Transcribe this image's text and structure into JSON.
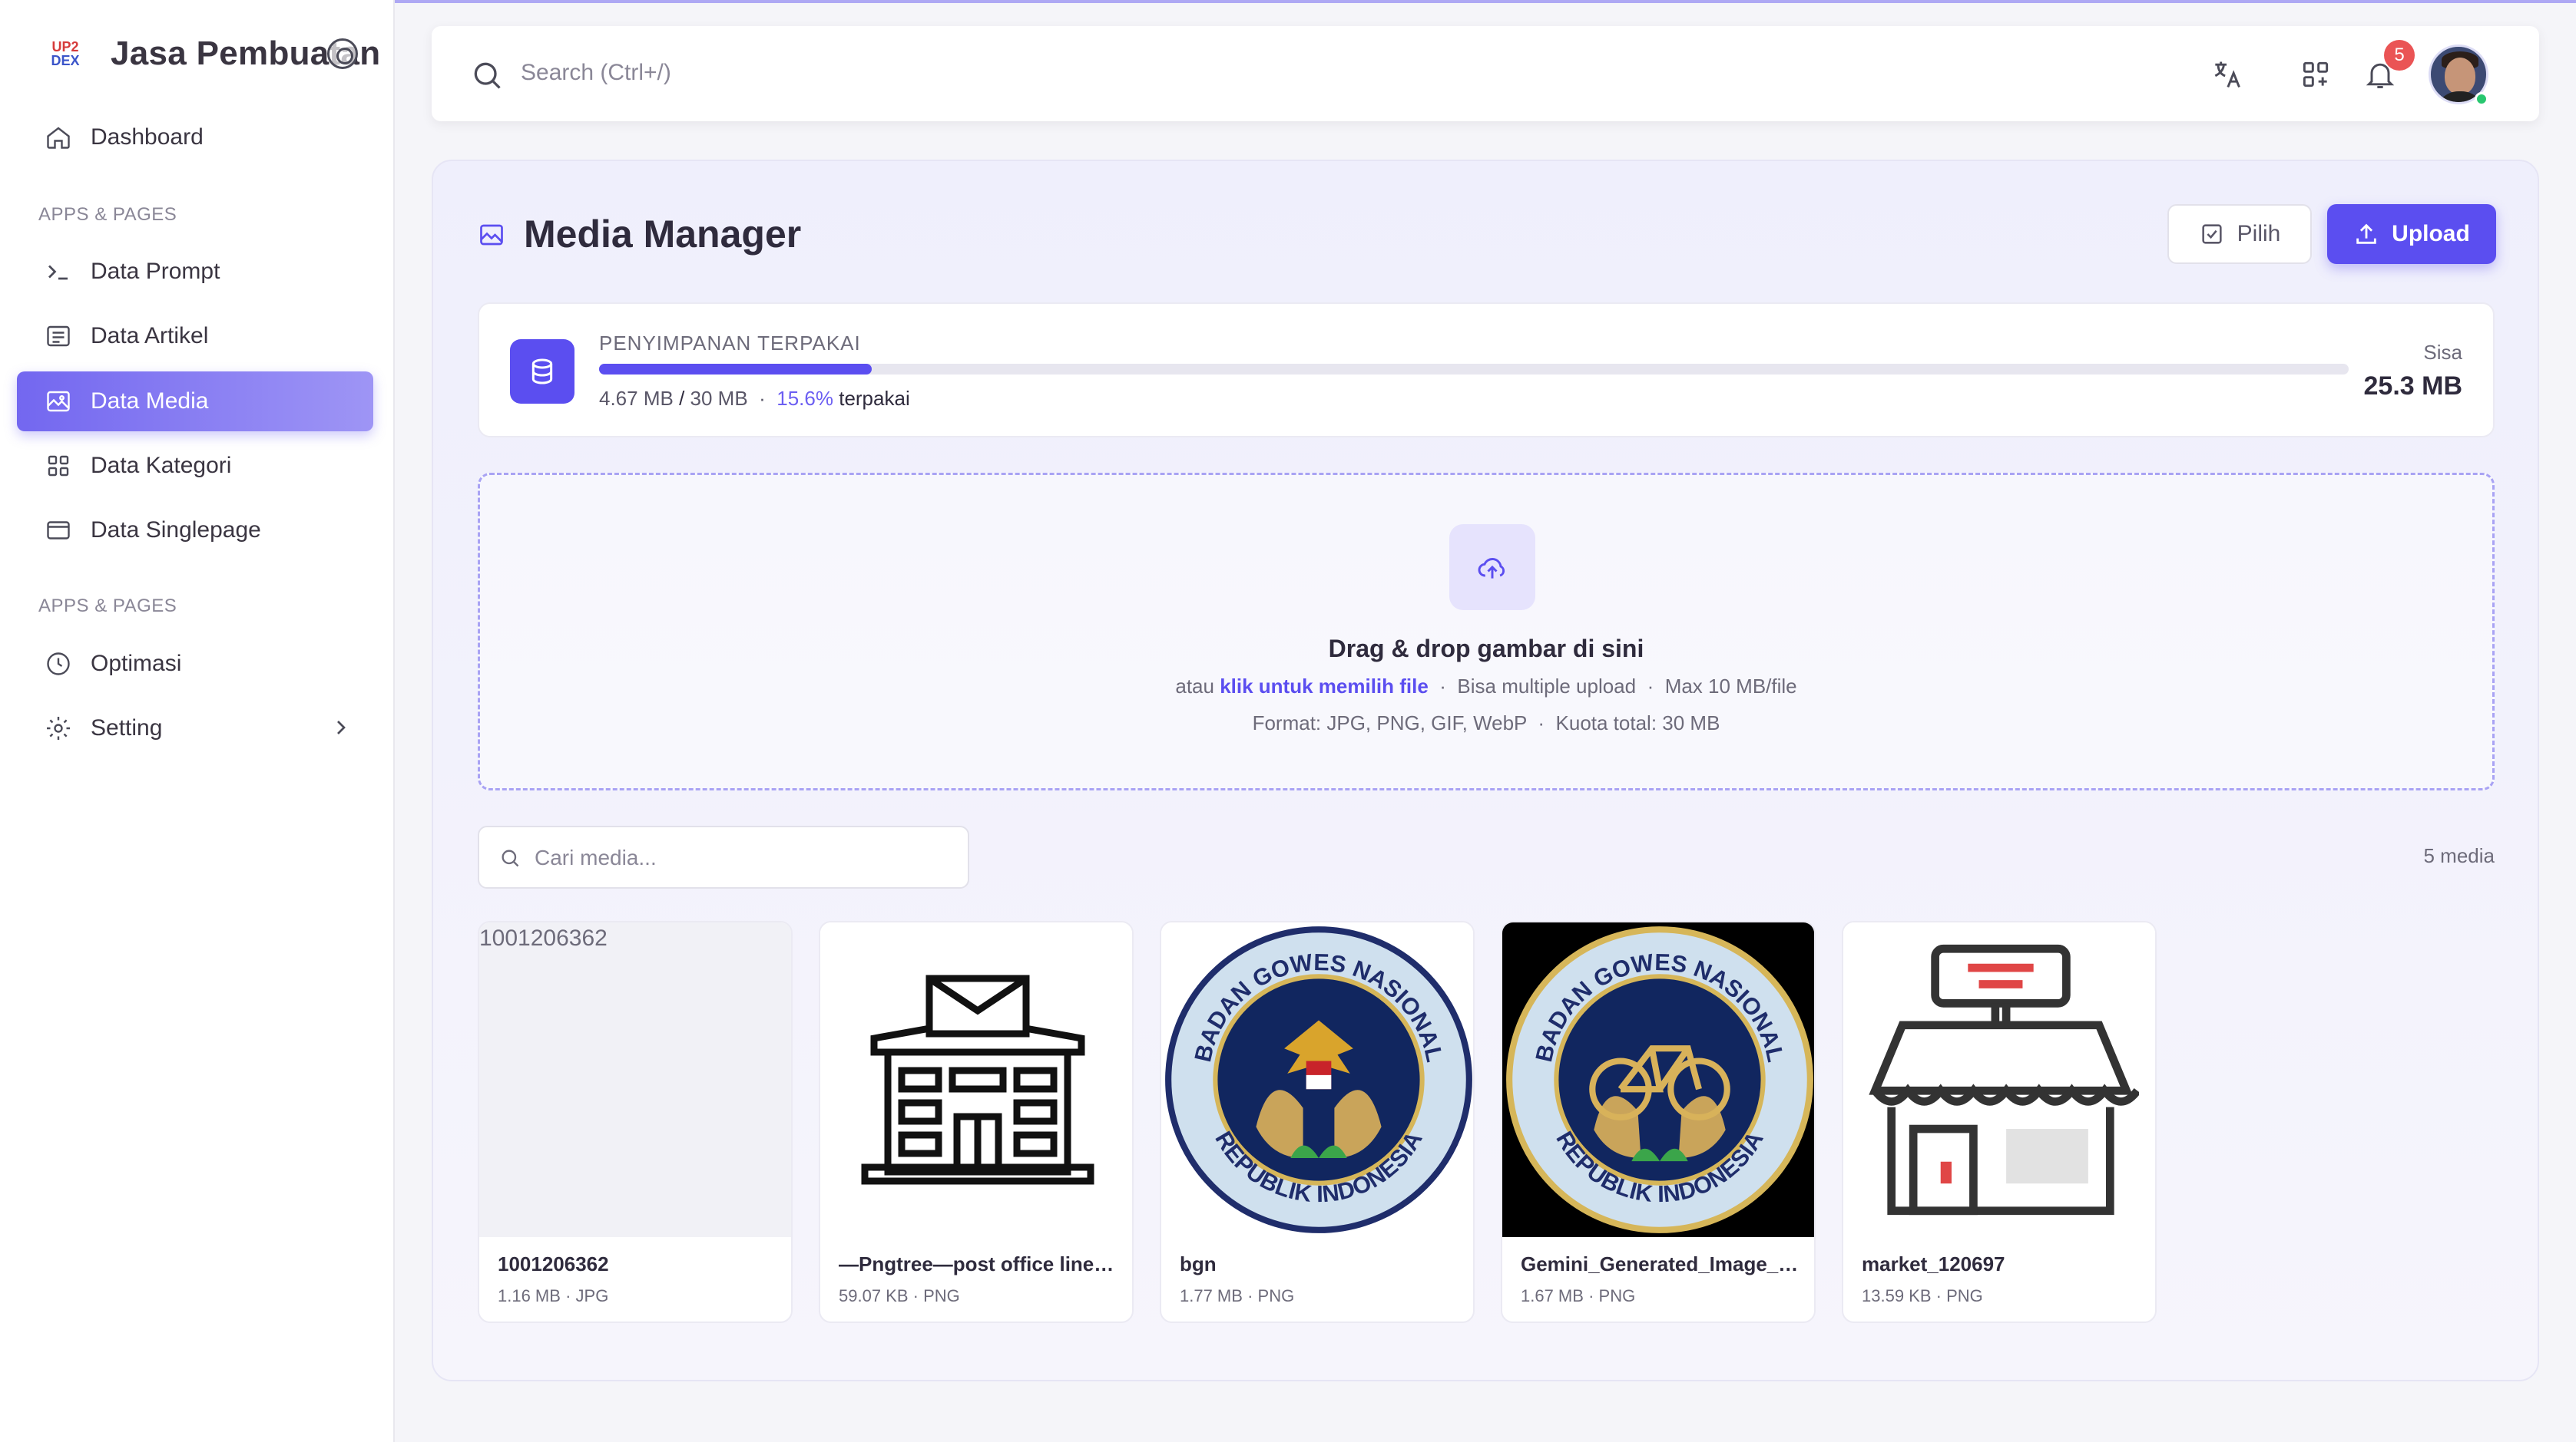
{
  "brand": {
    "logo_top": "UP2",
    "logo_bottom": "DEX",
    "name": "Jasa Pembuatan"
  },
  "sidebar": {
    "dashboard": "Dashboard",
    "section1": "APPS & PAGES",
    "items": [
      {
        "label": "Data Prompt",
        "icon": "terminal-icon"
      },
      {
        "label": "Data Artikel",
        "icon": "article-icon"
      },
      {
        "label": "Data Media",
        "icon": "image-icon",
        "active": true
      },
      {
        "label": "Data Kategori",
        "icon": "grid-icon"
      },
      {
        "label": "Data Singlepage",
        "icon": "window-icon"
      }
    ],
    "section2": "APPS & PAGES",
    "optimasi": "Optimasi",
    "setting": "Setting"
  },
  "header": {
    "search_placeholder": "Search (Ctrl+/)",
    "notification_count": "5"
  },
  "page": {
    "title": "Media Manager",
    "pilih_label": "Pilih",
    "upload_label": "Upload"
  },
  "storage": {
    "label": "PENYIMPANAN TERPAKAI",
    "used": "4.67 MB",
    "total": "30 MB",
    "percent_text": "15.6%",
    "percent_value": 15.6,
    "used_suffix": "terpakai",
    "sisa_label": "Sisa",
    "sisa_value": "25.3 MB"
  },
  "dropzone": {
    "title": "Drag & drop gambar di sini",
    "or": "atau",
    "link": "klik untuk memilih file",
    "multi": "Bisa multiple upload",
    "max": "Max 10 MB/file",
    "formats": "Format: JPG, PNG, GIF, WebP",
    "quota": "Kuota total: 30 MB"
  },
  "media_search": {
    "placeholder": "Cari media..."
  },
  "media_count": "5 media",
  "media": [
    {
      "name": "1001206362",
      "size": "1.16 MB",
      "type": "JPG",
      "alt": "1001206362"
    },
    {
      "name": "—Pngtree—post office line i...",
      "size": "59.07 KB",
      "type": "PNG"
    },
    {
      "name": "bgn",
      "size": "1.77 MB",
      "type": "PNG",
      "logo_top": "BADAN GOWES NASIONAL",
      "logo_bottom": "REPUBLIK INDONESIA"
    },
    {
      "name": "Gemini_Generated_Image_a...",
      "size": "1.67 MB",
      "type": "PNG",
      "logo_top": "BADAN GOWES NASIONAL",
      "logo_bottom": "REPUBLIK INDONESIA"
    },
    {
      "name": "market_120697",
      "size": "13.59 KB",
      "type": "PNG"
    }
  ],
  "separator": "·",
  "colors": {
    "accent": "#5b4ef0",
    "active_nav": "#7367f0",
    "badge": "#ea5455",
    "online": "#28c76f"
  }
}
